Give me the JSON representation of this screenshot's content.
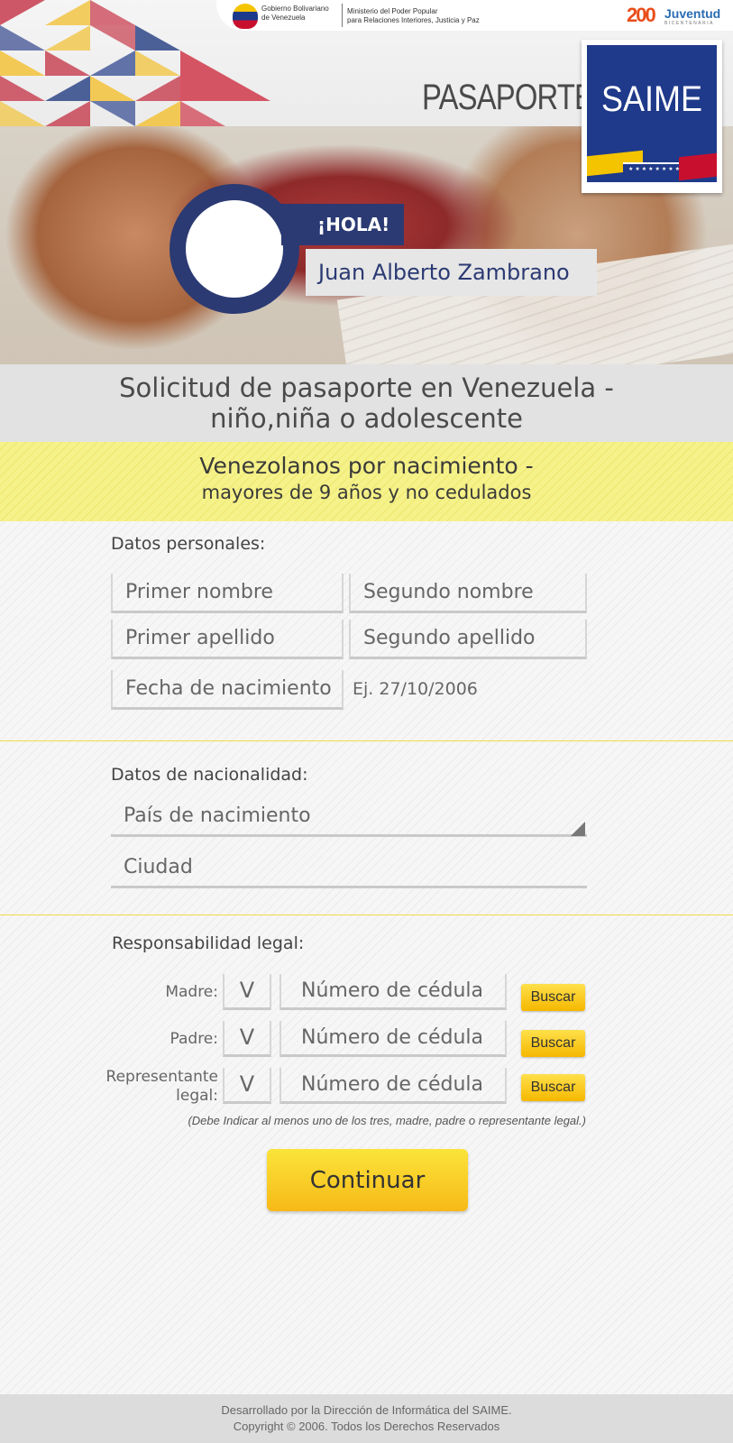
{
  "header": {
    "gov_logo_line1": "Gobierno Bolivariano",
    "gov_logo_line2": "de Venezuela",
    "ministry_line1": "Ministerio del Poder Popular",
    "ministry_line2": "para Relaciones Interiores, Justicia y Paz",
    "juventud_number": "200",
    "juventud_text": "Juventud",
    "juventud_sub": "BICENTENARIA",
    "page_label": "PASAPORTE",
    "brand": "SAIME",
    "greeting": "¡HOLA!",
    "user_name": "Juan Alberto Zambrano"
  },
  "title": {
    "line1": "Solicitud de pasaporte en Venezuela -",
    "line2": "niño,niña o adolescente"
  },
  "subtitle": {
    "line1": "Venezolanos por nacimiento -",
    "line2": "mayores de 9 años y no cedulados"
  },
  "personal": {
    "section_title": "Datos personales:",
    "first_name_placeholder": "Primer nombre",
    "second_name_placeholder": "Segundo nombre",
    "first_surname_placeholder": "Primer apellido",
    "second_surname_placeholder": "Segundo apellido",
    "birthdate_placeholder": "Fecha de nacimiento",
    "birthdate_hint": "Ej. 27/10/2006"
  },
  "nationality": {
    "section_title": "Datos de nacionalidad:",
    "country_placeholder": "País de nacimiento",
    "city_placeholder": "Ciudad"
  },
  "legal": {
    "section_title": "Responsabilidad legal:",
    "rows": [
      {
        "label": "Madre:",
        "prefix": "V",
        "id_placeholder": "Número de cédula",
        "button": "Buscar"
      },
      {
        "label": "Padre:",
        "prefix": "V",
        "id_placeholder": "Número de cédula",
        "button": "Buscar"
      },
      {
        "label": "Representante legal:",
        "prefix": "V",
        "id_placeholder": "Número de cédula",
        "button": "Buscar"
      }
    ],
    "note": "(Debe Indicar al menos uno de los tres, madre, padre o representante legal.)"
  },
  "continue_label": "Continuar",
  "footer": {
    "line1": "Desarrollado por la Dirección de Informática del SAIME.",
    "line2": "Copyright © 2006. Todos los Derechos Reservados"
  },
  "colors": {
    "navy": "#2b3a73",
    "brand_blue": "#1f3a8a",
    "yellow": "#f7b917",
    "band_yellow": "#f6f28a"
  }
}
